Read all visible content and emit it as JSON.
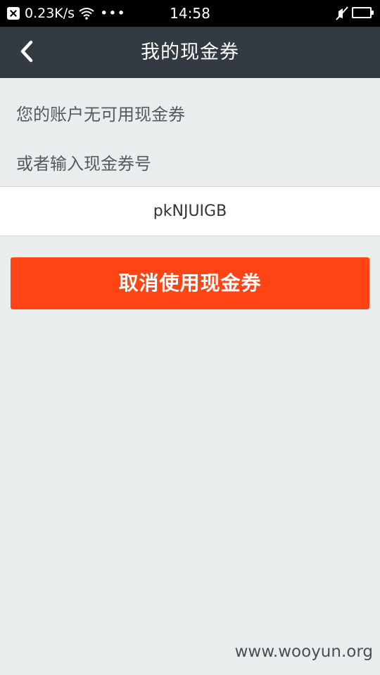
{
  "status_bar": {
    "network_speed": "0.23K/s",
    "more": "•••",
    "time": "14:58",
    "icons": [
      "notification-icon",
      "wifi-icon",
      "mute-icon",
      "battery-icon"
    ],
    "battery_level": 0
  },
  "nav": {
    "back_icon": "chevron-left-icon",
    "title": "我的现金券"
  },
  "content": {
    "no_coupon_text": "您的账户无可用现金券",
    "or_input_text": "或者输入现金券号",
    "coupon_code_value": "pkNJUIGB",
    "cancel_button_label": "取消使用现金券"
  },
  "watermark": "www.wooyun.org",
  "colors": {
    "nav_background": "#333a42",
    "accent_button": "#ff4516",
    "page_background": "#e9eded"
  }
}
